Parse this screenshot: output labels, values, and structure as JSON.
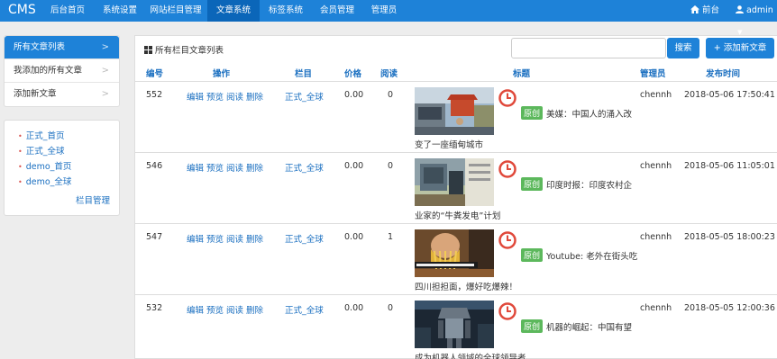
{
  "brand": "CMS",
  "nav": {
    "items": [
      "后台首页",
      "系统设置",
      "网站栏目管理",
      "文章系统",
      "标签系统",
      "会员管理",
      "管理员"
    ],
    "active_index": 3,
    "frontend": "前台",
    "user": "admin"
  },
  "left_menu": {
    "items": [
      {
        "label": "所有文章列表",
        "active": true
      },
      {
        "label": "我添加的所有文章",
        "active": false
      },
      {
        "label": "添加新文章",
        "active": false
      }
    ]
  },
  "columns_box": {
    "links": [
      "正式_首页",
      "正式_全球",
      "demo_首页",
      "demo_全球"
    ],
    "manage_label": "栏目管理"
  },
  "panel": {
    "title": "所有栏目文章列表",
    "search_placeholder": "",
    "search_label": "搜索",
    "add_label": "+ 添加新文章"
  },
  "table": {
    "headers": [
      "编号",
      "操作",
      "栏目",
      "价格",
      "阅读",
      "标题",
      "管理员",
      "发布时间"
    ],
    "action_labels": [
      "编辑",
      "预览",
      "阅读",
      "删除"
    ],
    "rows": [
      {
        "id": "552",
        "column": "正式_全球",
        "price": "0.00",
        "reads": "0",
        "badge": "原创",
        "title": "美媒：中国人的涌入改",
        "title_cont": "变了一座缅甸城市",
        "admin": "chennh",
        "time": "2018-05-06 17:50:41",
        "thumb": "street"
      },
      {
        "id": "546",
        "column": "正式_全球",
        "price": "0.00",
        "reads": "0",
        "badge": "原创",
        "title": "印度时报：印度农村企",
        "title_cont": "业家的“牛粪发电”计划",
        "admin": "chennh",
        "time": "2018-05-06 11:05:01",
        "thumb": "machine"
      },
      {
        "id": "547",
        "column": "正式_全球",
        "price": "0.00",
        "reads": "1",
        "badge": "原创",
        "title": "Youtube: 老外在街头吃",
        "title_cont": "四川担担面，爆好吃爆辣！",
        "admin": "chennh",
        "time": "2018-05-05 18:00:23",
        "thumb": "noodles"
      },
      {
        "id": "532",
        "column": "正式_全球",
        "price": "0.00",
        "reads": "0",
        "badge": "原创",
        "title": "机器的崛起：中国有望",
        "title_cont": "成为机器人领域的全球领导者",
        "admin": "chennh",
        "time": "2018-05-05 12:00:36",
        "thumb": "robot"
      }
    ]
  },
  "colors": {
    "primary": "#1e82d8",
    "active_nav": "#0b66b9",
    "badge": "#5cb85c",
    "clock": "#e0493b",
    "link": "#1a6fc0"
  }
}
